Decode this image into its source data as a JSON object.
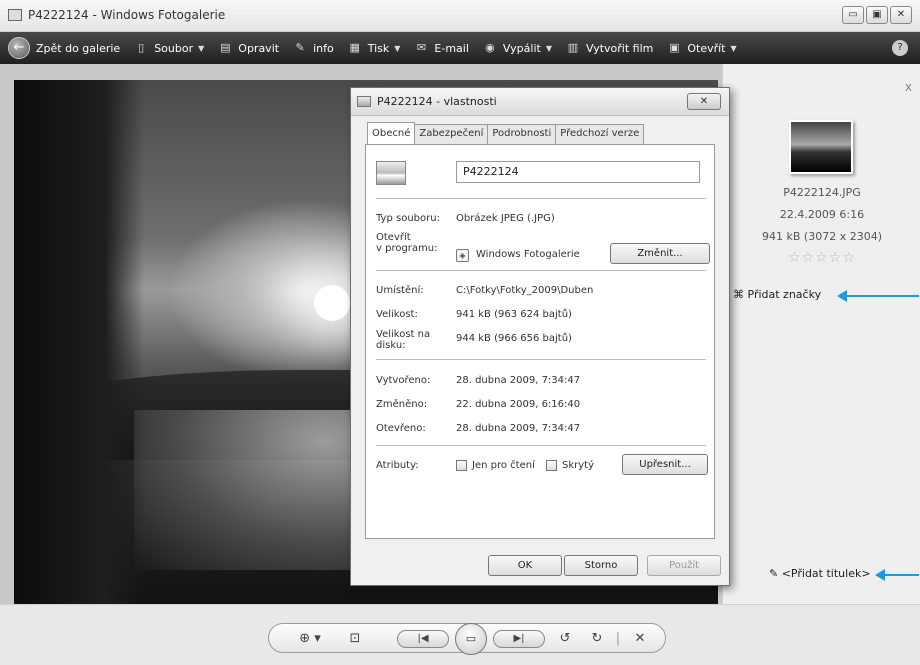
{
  "window": {
    "title": "P4222124 - Windows Fotogalerie",
    "controls": {
      "minimize": "▭",
      "maximize": "▣",
      "close": "✕"
    }
  },
  "toolbar": {
    "back": "Zpět do galerie",
    "file": "Soubor",
    "fix": "Opravit",
    "info": "info",
    "print": "Tisk",
    "email": "E-mail",
    "burn": "Vypálit",
    "movie": "Vytvořit film",
    "open": "Otevřít",
    "help": "?"
  },
  "info_panel": {
    "close": "x",
    "filename": "P4222124.JPG",
    "datetime": "22.4.2009   6:16",
    "size": "941 kB (3072 x 2304)",
    "stars": "☆☆☆☆☆",
    "rating": 0,
    "add_tags": "Přidat značky",
    "add_caption": "<Přidat titulek>",
    "accent_color": "#1f9ad6"
  },
  "dialog": {
    "title": "P4222124 - vlastnosti",
    "close": "✕",
    "tabs": [
      "Obecné",
      "Zabezpečení",
      "Podrobnosti",
      "Předchozí verze"
    ],
    "name": "P4222124",
    "type_label": "Typ souboru:",
    "type_value": "Obrázek JPEG (.JPG)",
    "opens_label_1": "Otevřít",
    "opens_label_2": "v programu:",
    "opens_value": "Windows Fotogalerie",
    "change_button": "Změnit...",
    "location_label": "Umístění:",
    "location_value": "C:\\Fotky\\Fotky_2009\\Duben",
    "size_label": "Velikost:",
    "size_value": "941 kB (963 624 bajtů)",
    "disk_label_1": "Velikost na",
    "disk_label_2": "disku:",
    "disk_value": "944 kB (966 656 bajtů)",
    "created_label": "Vytvořeno:",
    "created_value": "28. dubna 2009, 7:34:47",
    "modified_label": "Změněno:",
    "modified_value": "22. dubna 2009, 6:16:40",
    "accessed_label": "Otevřeno:",
    "accessed_value": "28. dubna 2009, 7:34:47",
    "attributes_label": "Atributy:",
    "readonly_label": "Jen pro čtení",
    "hidden_label": "Skrytý",
    "advanced_button": "Upřesnit...",
    "ok_button": "OK",
    "cancel_button": "Storno",
    "apply_button": "Použít"
  },
  "bottom_controls": {
    "zoom": "⊕ ▾",
    "fit": "⊡",
    "prev": "|◀",
    "slideshow": "▭",
    "next": "▶|",
    "rotate_left": "↺",
    "rotate_right": "↻",
    "divider": "|",
    "delete": "✕"
  }
}
